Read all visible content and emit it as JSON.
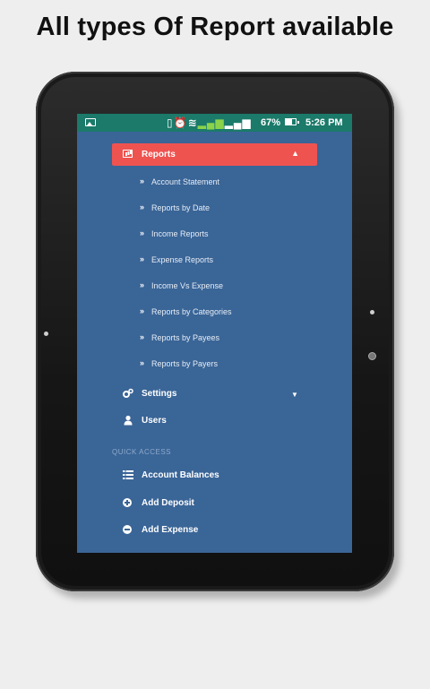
{
  "headline": "All types Of Report available",
  "status_bar": {
    "battery": "67%",
    "time": "5:26 PM"
  },
  "menu": {
    "reports": {
      "label": "Reports",
      "items": [
        "Account Statement",
        "Reports by Date",
        "Income Reports",
        "Expense Reports",
        "Income Vs Expense",
        "Reports by Categories",
        "Reports by Payees",
        "Reports by Payers"
      ]
    },
    "settings": "Settings",
    "users": "Users",
    "quick_access": {
      "title": "QUICK ACCESS",
      "account_balances": "Account Balances",
      "add_deposit": "Add Deposit",
      "add_expense": "Add Expense"
    }
  },
  "colors": {
    "drawer_bg": "#3a6597",
    "active_item": "#ef5350",
    "status_bar": "#1b7a6a"
  }
}
